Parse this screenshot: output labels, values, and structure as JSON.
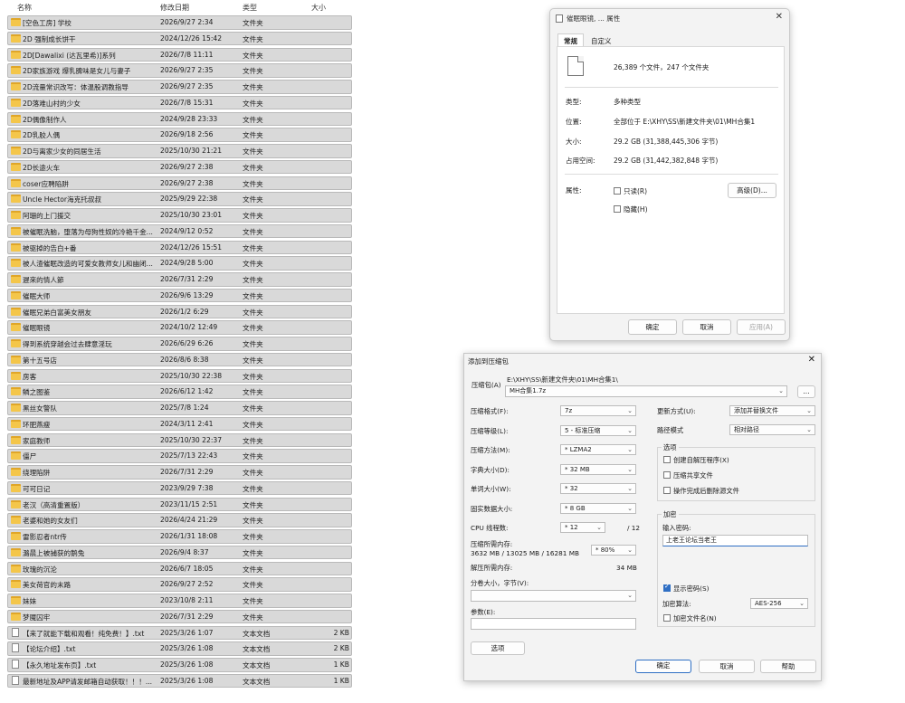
{
  "explorer": {
    "headers": {
      "name": "名称",
      "date": "修改日期",
      "type": "类型",
      "size": "大小"
    },
    "rows": [
      {
        "icon": "folder-icon",
        "name": "[空色工房] 学校",
        "date": "2026/9/27 2:34",
        "type": "文件夹",
        "size": ""
      },
      {
        "icon": "folder-icon",
        "name": "2D 强制成长饼干",
        "date": "2024/12/26 15:42",
        "type": "文件夹",
        "size": ""
      },
      {
        "icon": "folder-icon",
        "name": "2D[Dawalixi (达瓦里希)]系列",
        "date": "2026/7/8 11:11",
        "type": "文件夹",
        "size": ""
      },
      {
        "icon": "folder-icon",
        "name": "2D家族游戏 爆乳脾味是女儿与妻子",
        "date": "2026/9/27 2:35",
        "type": "文件夹",
        "size": ""
      },
      {
        "icon": "folder-icon",
        "name": "2D流量常识改写：体温股调教指导",
        "date": "2026/9/27 2:35",
        "type": "文件夹",
        "size": ""
      },
      {
        "icon": "folder-icon",
        "name": "2D落难山村的少女",
        "date": "2026/7/8 15:31",
        "type": "文件夹",
        "size": ""
      },
      {
        "icon": "folder-icon",
        "name": "2D偶像制作人",
        "date": "2024/9/28 23:33",
        "type": "文件夹",
        "size": ""
      },
      {
        "icon": "folder-icon",
        "name": "2D乳胶人偶",
        "date": "2026/9/18 2:56",
        "type": "文件夹",
        "size": ""
      },
      {
        "icon": "folder-icon",
        "name": "2D与离家少女的同居生活",
        "date": "2025/10/30 21:21",
        "type": "文件夹",
        "size": ""
      },
      {
        "icon": "folder-icon",
        "name": "2D长途火车",
        "date": "2026/9/27 2:38",
        "type": "文件夹",
        "size": ""
      },
      {
        "icon": "folder-icon",
        "name": "coser应聘陷阱",
        "date": "2026/9/27 2:38",
        "type": "文件夹",
        "size": ""
      },
      {
        "icon": "folder-icon",
        "name": "Uncle Hector海克托叔叔",
        "date": "2025/9/29 22:38",
        "type": "文件夹",
        "size": ""
      },
      {
        "icon": "folder-icon",
        "name": "阿珊的上门援交",
        "date": "2025/10/30 23:01",
        "type": "文件夹",
        "size": ""
      },
      {
        "icon": "folder-icon",
        "name": "被催眠洗脑，堕落为母狗性奴的冷艳千金...",
        "date": "2024/9/12 0:52",
        "type": "文件夹",
        "size": ""
      },
      {
        "icon": "folder-icon",
        "name": "被驱掉的告白+番",
        "date": "2024/12/26 15:51",
        "type": "文件夹",
        "size": ""
      },
      {
        "icon": "folder-icon",
        "name": "被人渣催眠改造的可爱女教师女儿和幽闭...",
        "date": "2024/9/28 5:00",
        "type": "文件夹",
        "size": ""
      },
      {
        "icon": "folder-icon",
        "name": "遲來的情人節",
        "date": "2026/7/31 2:29",
        "type": "文件夹",
        "size": ""
      },
      {
        "icon": "folder-icon",
        "name": "催眠大师",
        "date": "2026/9/6 13:29",
        "type": "文件夹",
        "size": ""
      },
      {
        "icon": "folder-icon",
        "name": "催眠兄弟白富美女朋友",
        "date": "2026/1/2 6:29",
        "type": "文件夹",
        "size": ""
      },
      {
        "icon": "folder-icon",
        "name": "催眠眼镜",
        "date": "2024/10/2 12:49",
        "type": "文件夹",
        "size": ""
      },
      {
        "icon": "folder-icon",
        "name": "得到系统穿越会过去肆意淫玩",
        "date": "2026/6/29 6:26",
        "type": "文件夹",
        "size": ""
      },
      {
        "icon": "folder-icon",
        "name": "第十五号店",
        "date": "2026/8/6 8:38",
        "type": "文件夹",
        "size": ""
      },
      {
        "icon": "folder-icon",
        "name": "房客",
        "date": "2025/10/30 22:38",
        "type": "文件夹",
        "size": ""
      },
      {
        "icon": "folder-icon",
        "name": "鳞之图鉴",
        "date": "2026/6/12 1:42",
        "type": "文件夹",
        "size": ""
      },
      {
        "icon": "folder-icon",
        "name": "黑丝女警队",
        "date": "2025/7/8 1:24",
        "type": "文件夹",
        "size": ""
      },
      {
        "icon": "folder-icon",
        "name": "环肥燕瘦",
        "date": "2024/3/11 2:41",
        "type": "文件夹",
        "size": ""
      },
      {
        "icon": "folder-icon",
        "name": "家庭教师",
        "date": "2025/10/30 22:37",
        "type": "文件夹",
        "size": ""
      },
      {
        "icon": "folder-icon",
        "name": "僵尸",
        "date": "2025/7/13 22:43",
        "type": "文件夹",
        "size": ""
      },
      {
        "icon": "folder-icon",
        "name": "绕理陷阱",
        "date": "2026/7/31 2:29",
        "type": "文件夹",
        "size": ""
      },
      {
        "icon": "folder-icon",
        "name": "可可日记",
        "date": "2023/9/29 7:38",
        "type": "文件夹",
        "size": ""
      },
      {
        "icon": "folder-icon",
        "name": "老汉（高清重置版）",
        "date": "2023/11/15 2:51",
        "type": "文件夹",
        "size": ""
      },
      {
        "icon": "folder-icon",
        "name": "老婆和她的女友们",
        "date": "2026/4/24 21:29",
        "type": "文件夹",
        "size": ""
      },
      {
        "icon": "folder-icon",
        "name": "雷影忍者ntr传",
        "date": "2026/1/31 18:08",
        "type": "文件夹",
        "size": ""
      },
      {
        "icon": "folder-icon",
        "name": "潞晨上被捕获的鹅兔",
        "date": "2026/9/4 8:37",
        "type": "文件夹",
        "size": ""
      },
      {
        "icon": "folder-icon",
        "name": "玫瑰的沉沦",
        "date": "2026/6/7 18:05",
        "type": "文件夹",
        "size": ""
      },
      {
        "icon": "folder-icon",
        "name": "美女荷官的末路",
        "date": "2026/9/27 2:52",
        "type": "文件夹",
        "size": ""
      },
      {
        "icon": "folder-icon",
        "name": "妹妹",
        "date": "2023/10/8 2:11",
        "type": "文件夹",
        "size": ""
      },
      {
        "icon": "folder-icon",
        "name": "梦魇囚牢",
        "date": "2026/7/31 2:29",
        "type": "文件夹",
        "size": ""
      },
      {
        "icon": "text-file-icon",
        "name": "【来了就能下载和观看！纯免费！】.txt",
        "date": "2025/3/26 1:07",
        "type": "文本文档",
        "size": "2 KB"
      },
      {
        "icon": "text-file-icon",
        "name": "【论坛介绍】.txt",
        "date": "2025/3/26 1:08",
        "type": "文本文档",
        "size": "2 KB"
      },
      {
        "icon": "text-file-icon",
        "name": "【永久地址发布页】.txt",
        "date": "2025/3/26 1:08",
        "type": "文本文档",
        "size": "1 KB"
      },
      {
        "icon": "text-file-icon",
        "name": "最新地址及APP请发邮箱自动获取！！！...",
        "date": "2025/3/26 1:08",
        "type": "文本文档",
        "size": "1 KB"
      }
    ]
  },
  "properties": {
    "title": "催眠眼镜, ... 属性",
    "close": "✕",
    "tabs": [
      "常规",
      "自定义"
    ],
    "summary": "26,389 个文件，247 个文件夹",
    "fields": [
      {
        "label": "类型:",
        "value": "多种类型"
      },
      {
        "label": "位置:",
        "value": "全部位于 E:\\XHY\\SS\\新建文件夹\\01\\MH合集1"
      },
      {
        "label": "大小:",
        "value": "29.2 GB (31,388,445,306 字节)"
      },
      {
        "label": "占用空间:",
        "value": "29.2 GB (31,442,382,848 字节)"
      }
    ],
    "attributes_label": "属性:",
    "readonly": "只读(R)",
    "hidden": "隐藏(H)",
    "advanced": "高级(D)...",
    "ok": "确定",
    "cancel": "取消",
    "apply": "应用(A)"
  },
  "archive": {
    "title": "添加到压缩包",
    "close": "✕",
    "archive_label": "压缩包(A)",
    "archive_path": "E:\\XHY\\SS\\新建文件夹\\01\\MH合集1\\",
    "archive_name": "MH合集1.7z",
    "browse": "...",
    "format_label": "压缩格式(F):",
    "format_value": "7z",
    "level_label": "压缩等级(L):",
    "level_value": "5 - 标准压缩",
    "method_label": "压缩方法(M):",
    "method_value": "* LZMA2",
    "dict_label": "字典大小(D):",
    "dict_value": "* 32 MB",
    "word_label": "单词大小(W):",
    "word_value": "* 32",
    "solid_label": "固实数据大小:",
    "solid_value": "* 8 GB",
    "cpu_label": "CPU 线程数:",
    "cpu_value": "* 12",
    "cpu_total": "/ 12",
    "mem_comp_label": "压缩所需内存:",
    "mem_comp_detail": "3632 MB / 13025 MB / 16281 MB",
    "mem_comp_percent": "* 80%",
    "mem_decomp_label": "解压所需内存:",
    "mem_decomp_value": "34 MB",
    "split_label": "分卷大小，字节(V):",
    "params_label": "参数(E):",
    "options_button": "选项",
    "update_label": "更新方式(U):",
    "update_value": "添加并替换文件",
    "path_label": "路径模式",
    "path_value": "相对路径",
    "options_group": "选项",
    "opt_sfx": "创建自解压程序(X)",
    "opt_shared": "压缩共享文件",
    "opt_delete": "操作完成后删除源文件",
    "encrypt_group": "加密",
    "password_label": "输入密码:",
    "password_value": "上老王论坛当老王",
    "show_password": "显示密码(S)",
    "enc_method_label": "加密算法:",
    "enc_method_value": "AES-256",
    "encrypt_names": "加密文件名(N)",
    "ok": "确定",
    "cancel": "取消",
    "help": "帮助"
  }
}
